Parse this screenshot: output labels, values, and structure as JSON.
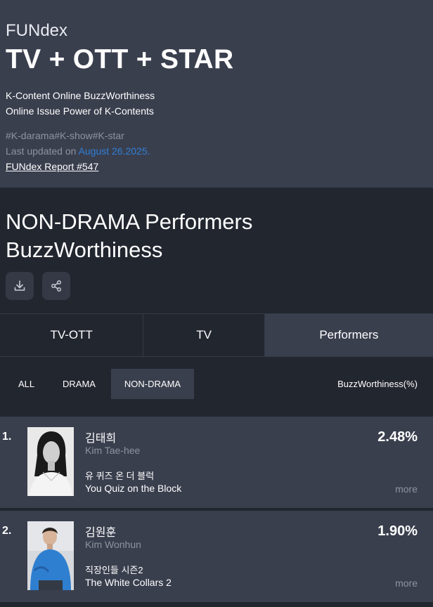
{
  "header": {
    "brand": "FUNdex",
    "title": "TV + OTT + STAR",
    "desc_line1": "K-Content Online BuzzWorthiness",
    "desc_line2": "Online Issue Power of K-Contents",
    "tags": "#K-darama#K-show#K-star",
    "updated_prefix": "Last updated on ",
    "updated_date": "August 26.2025.",
    "report_link": "FUNdex Report #547"
  },
  "section": {
    "title_line1": "NON-DRAMA Performers",
    "title_line2": "BuzzWorthiness",
    "download_icon": "download-icon",
    "share_icon": "share-icon"
  },
  "tabs": [
    "TV-OTT",
    "TV",
    "Performers"
  ],
  "active_tab": "Performers",
  "subtabs": [
    "ALL",
    "DRAMA",
    "NON-DRAMA"
  ],
  "active_subtab": "NON-DRAMA",
  "column_header": "BuzzWorthiness(%)",
  "rankings": [
    {
      "rank": "1.",
      "name_ko": "김태희",
      "name_en": "Kim Tae-hee",
      "show_ko": "유 퀴즈 온 더 블럭",
      "show_en": "You Quiz on the Block",
      "percent": "2.48%",
      "more": "more"
    },
    {
      "rank": "2.",
      "name_ko": "김원훈",
      "name_en": "Kim Wonhun",
      "show_ko": "직장인들 시즌2",
      "show_en": "The White Collars 2",
      "percent": "1.90%",
      "more": "more"
    }
  ],
  "colors": {
    "header_bg": "#3a3f4e",
    "page_bg": "#22262f",
    "link_blue": "#2f7fd6",
    "muted_text": "#8e93a0"
  }
}
